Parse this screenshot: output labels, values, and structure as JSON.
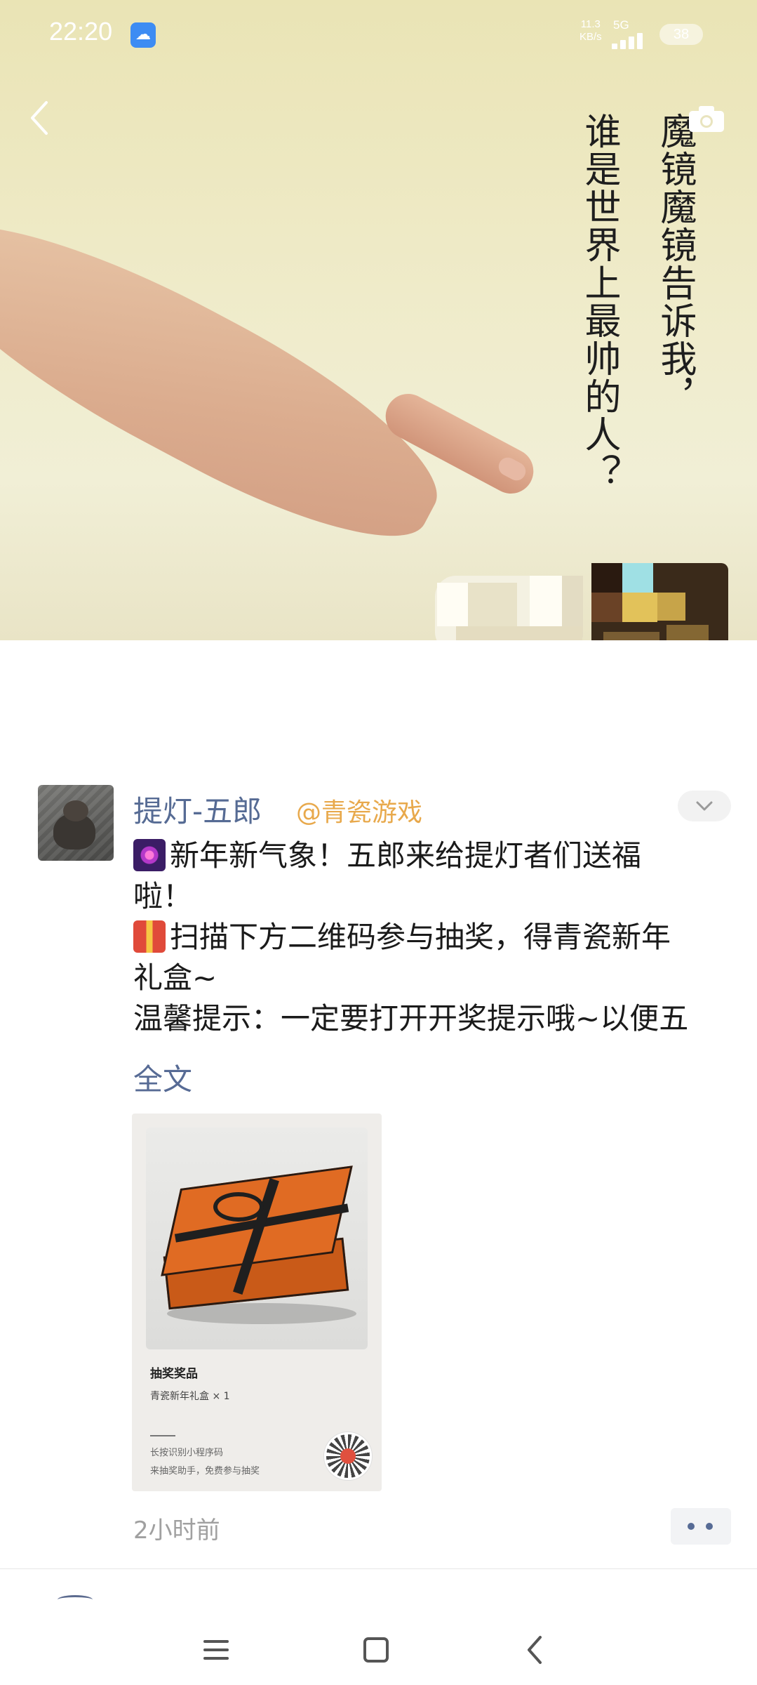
{
  "status_bar": {
    "time": "22:20",
    "net_speed_value": "11.3",
    "net_speed_unit": "KB/s",
    "network": "5G",
    "battery": "38"
  },
  "cover": {
    "text_line1": "魔镜魔镜告诉我，",
    "text_line2": "谁是世界上最帅的人？"
  },
  "post": {
    "username": "提灯-五郎",
    "mention": "@青瓷游戏",
    "lines": [
      "新年新气象！五郎来给提灯者们送福",
      "啦！",
      "扫描下方二维码参与抽奖，得青瓷新年",
      "礼盒~",
      "温馨提示：一定要打开开奖提示哦~以便五"
    ],
    "full_text_link": "全文",
    "timestamp": "2小时前"
  },
  "card": {
    "prize_title": "抽奖奖品",
    "prize_item": "青瓷新年礼盒 × 1",
    "hint1": "长按识别小程序码",
    "hint2": "来抽奖助手，免费参与抽奖"
  },
  "icons": {
    "back": "chevron-left-icon",
    "camera": "camera-icon",
    "menu": "chevron-down-icon",
    "comment": "more-dots-icon",
    "nav_recent": "menu-lines-icon",
    "nav_home": "square-icon",
    "nav_back": "chevron-left-icon"
  },
  "colors": {
    "username": "#566b94",
    "mention": "#e8a94c",
    "link": "#576b95",
    "timestamp": "#a0a0a0"
  }
}
